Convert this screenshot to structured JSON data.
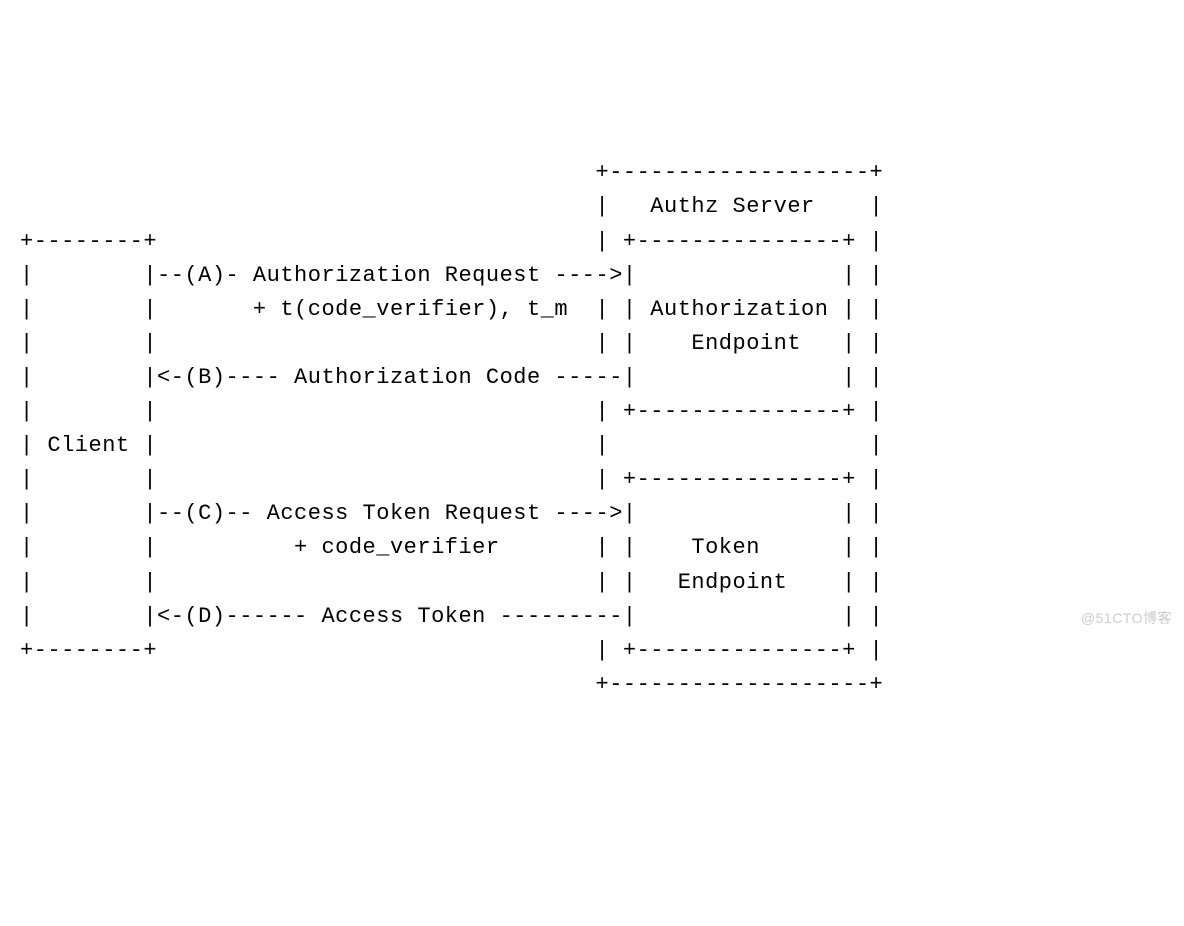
{
  "diagram": {
    "lines": [
      "                                          +-------------------+",
      "                                          |   Authz Server    |",
      "+--------+                                | +---------------+ |",
      "|        |--(A)- Authorization Request ---->|               | |",
      "|        |       + t(code_verifier), t_m  | | Authorization | |",
      "|        |                                | |    Endpoint   | |",
      "|        |<-(B)---- Authorization Code -----|               | |",
      "|        |                                | +---------------+ |",
      "| Client |                                |                   |",
      "|        |                                | +---------------+ |",
      "|        |--(C)-- Access Token Request ---->|               | |",
      "|        |          + code_verifier       | |    Token      | |",
      "|        |                                | |   Endpoint    | |",
      "|        |<-(D)------ Access Token ---------|               | |",
      "+--------+                                | +---------------+ |",
      "                                          +-------------------+"
    ],
    "entities": {
      "client": "Client",
      "server": "Authz Server",
      "authz_endpoint": "Authorization Endpoint",
      "token_endpoint": "Token Endpoint"
    },
    "flows": {
      "A": {
        "label": "Authorization Request",
        "extra": "+ t(code_verifier), t_m",
        "direction": "right"
      },
      "B": {
        "label": "Authorization Code",
        "direction": "left"
      },
      "C": {
        "label": "Access Token Request",
        "extra": "+ code_verifier",
        "direction": "right"
      },
      "D": {
        "label": "Access Token",
        "direction": "left"
      }
    }
  },
  "watermark": "@51CTO博客"
}
